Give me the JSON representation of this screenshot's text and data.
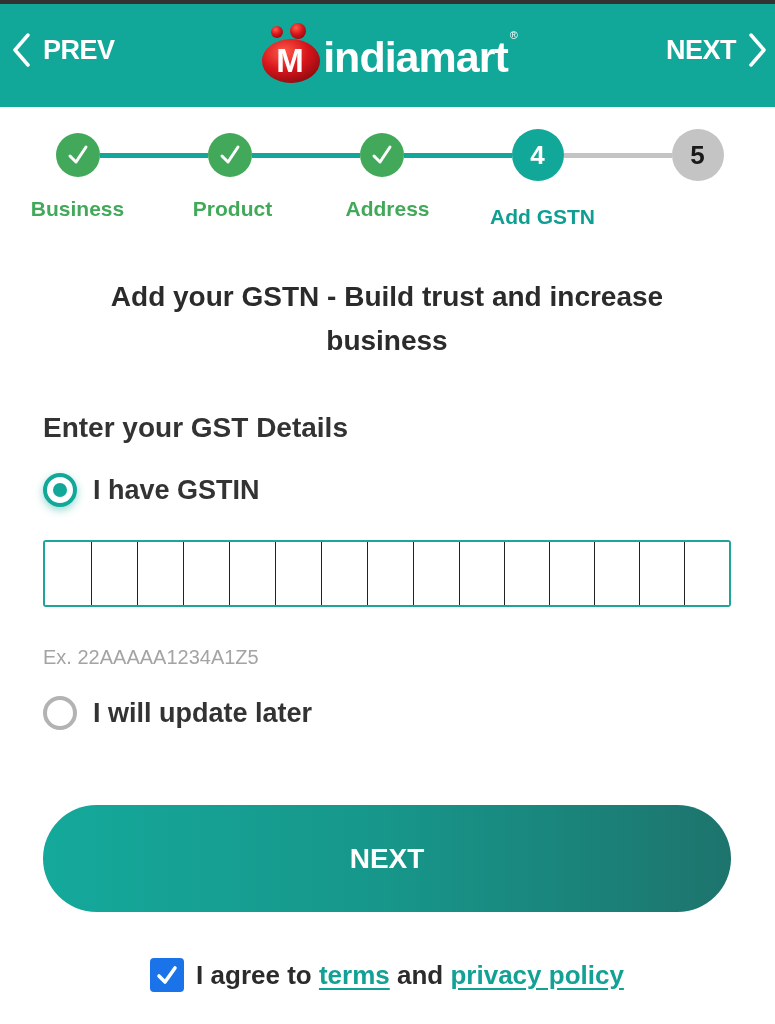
{
  "header": {
    "prev": {
      "label": "PREV"
    },
    "logo": {
      "letter": "M",
      "name": "indiamart",
      "mark": "®"
    },
    "next": {
      "label": "NEXT"
    }
  },
  "steps": [
    {
      "label": "Business",
      "completed": true,
      "selected": false
    },
    {
      "label": "Product",
      "completed": true,
      "selected": false
    },
    {
      "label": "Address",
      "completed": true,
      "selected": false
    },
    {
      "label": "Add GSTN",
      "number": "4",
      "completed": false,
      "selected": true
    },
    {
      "number": "5",
      "completed": false,
      "selected": false
    }
  ],
  "heading": "Add your GSTN - Build trust and increase business",
  "gst_section": {
    "title": "Enter your GST Details",
    "options": [
      {
        "kind": "gstin",
        "label": "I have GSTIN",
        "selected": true,
        "hint": "Ex. 22AAAAA1234A1Z5"
      },
      {
        "kind": "plain",
        "label": "I will update later",
        "selected": false
      }
    ]
  },
  "next_button": {
    "label": "NEXT"
  },
  "agreement": {
    "checked": true,
    "parts": [
      {
        "kind": "text",
        "text": "I agree to"
      },
      {
        "kind": "link",
        "text": "terms"
      },
      {
        "kind": "text",
        "text": "and"
      },
      {
        "kind": "link",
        "text": "privacy policy"
      }
    ]
  }
}
